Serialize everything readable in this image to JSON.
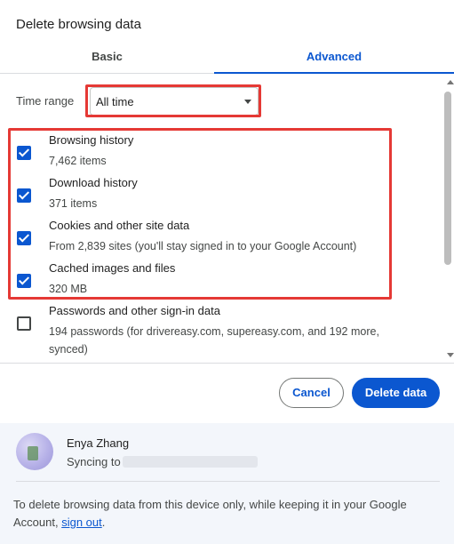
{
  "dialog": {
    "title": "Delete browsing data"
  },
  "tabs": [
    {
      "label": "Basic",
      "selected": false
    },
    {
      "label": "Advanced",
      "selected": true
    }
  ],
  "time_range": {
    "label": "Time range",
    "value": "All time"
  },
  "items": [
    {
      "title": "Browsing history",
      "subtitle": "7,462 items",
      "checked": true
    },
    {
      "title": "Download history",
      "subtitle": "371 items",
      "checked": true
    },
    {
      "title": "Cookies and other site data",
      "subtitle": "From 2,839 sites (you'll stay signed in to your Google Account)",
      "checked": true
    },
    {
      "title": "Cached images and files",
      "subtitle": "320 MB",
      "checked": true
    },
    {
      "title": "Passwords and other sign-in data",
      "subtitle": "194 passwords (for drivereasy.com, supereasy.com, and 192 more, synced)",
      "checked": false
    }
  ],
  "buttons": {
    "cancel": "Cancel",
    "delete": "Delete data"
  },
  "account": {
    "name": "Enya Zhang",
    "sync_label": "Syncing to"
  },
  "note": {
    "text": "To delete browsing data from this device only, while keeping it in your Google Account, ",
    "link": "sign out",
    "end": "."
  },
  "colors": {
    "accent": "#0b57d0",
    "highlight": "#e53935",
    "account_bg": "#f3f6fb"
  }
}
